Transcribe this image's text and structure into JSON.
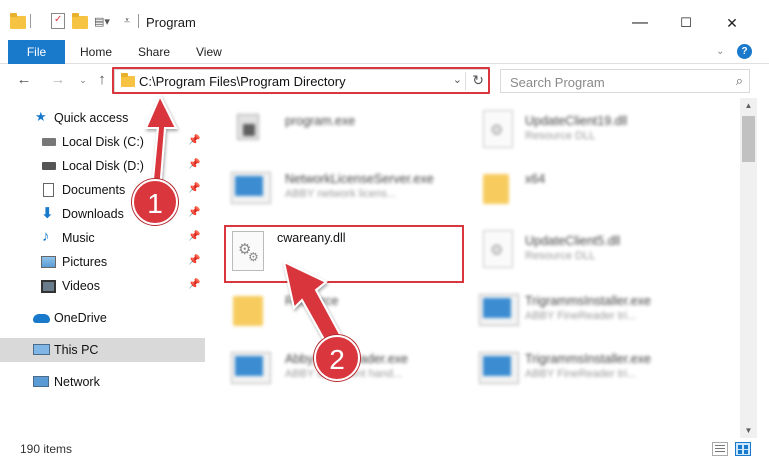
{
  "window": {
    "title": "Program",
    "controls": [
      "—",
      "☐",
      "✕"
    ]
  },
  "ribbon": {
    "file": "File",
    "tabs": [
      "Home",
      "Share",
      "View"
    ]
  },
  "address": {
    "path": "C:\\Program Files\\Program Directory"
  },
  "search": {
    "placeholder": "Search Program"
  },
  "navpane": {
    "items": [
      {
        "label": "Quick access",
        "icon": "star-icon",
        "pinned": false
      },
      {
        "label": "Local Disk (C:)",
        "icon": "drive-icon",
        "pinned": true
      },
      {
        "label": "Local Disk (D:)",
        "icon": "drive-icon",
        "pinned": true
      },
      {
        "label": "Documents",
        "icon": "documents-icon",
        "pinned": true
      },
      {
        "label": "Downloads",
        "icon": "download-icon",
        "pinned": true
      },
      {
        "label": "Music",
        "icon": "music-icon",
        "pinned": true
      },
      {
        "label": "Pictures",
        "icon": "pictures-icon",
        "pinned": true
      },
      {
        "label": "Videos",
        "icon": "videos-icon",
        "pinned": true
      },
      {
        "label": "OneDrive",
        "icon": "cloud-icon",
        "pinned": false
      },
      {
        "label": "This PC",
        "icon": "computer-icon",
        "pinned": false,
        "selected": true
      },
      {
        "label": "Network",
        "icon": "network-icon",
        "pinned": false
      }
    ]
  },
  "files": {
    "left": [
      {
        "name": "program.exe",
        "sub": ""
      },
      {
        "name": "NetworkLicenseServer.exe",
        "sub": "ABBY network licens..."
      },
      {
        "name": "cwareany.dll",
        "sub": ""
      },
      {
        "name": "Resource",
        "sub": ""
      },
      {
        "name": "AbbyyFineReader.exe",
        "sub": "ABBY document hand..."
      }
    ],
    "right": [
      {
        "name": "UpdateClient19.dll",
        "sub": "Resource DLL"
      },
      {
        "name": "x64",
        "sub": ""
      },
      {
        "name": "UpdateClient5.dll",
        "sub": "Resource DLL"
      },
      {
        "name": "TrigrammsInstaller.exe",
        "sub": "ABBY FineReader tri..."
      },
      {
        "name": "TrigrammsInstaller.exe",
        "sub": "ABBY FineReader tri..."
      }
    ]
  },
  "status": {
    "items_count": "190 items"
  },
  "callouts": [
    "1",
    "2"
  ],
  "colors": {
    "accent": "#1979ca",
    "highlight": "#d9363e",
    "folder": "#f6c343"
  }
}
